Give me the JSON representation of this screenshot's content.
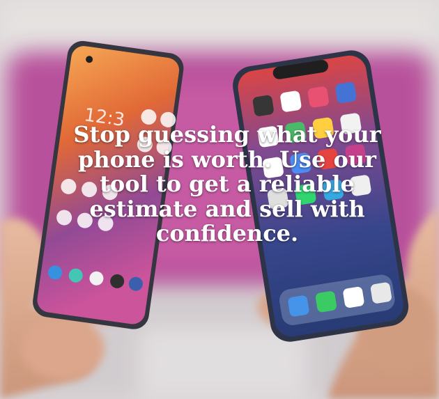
{
  "hero": {
    "headline": "Stop guessing what your phone is worth. Use our tool to get a reliable estimate and sell with confidence."
  },
  "image": {
    "subject": "two-hands-holding-smartphones",
    "colors": {
      "backdrop": "#d9d4d6",
      "magenta_glow": "#b0388f",
      "left_wallpaper": "#e0602a",
      "right_screen": "#1b2f6c"
    }
  }
}
